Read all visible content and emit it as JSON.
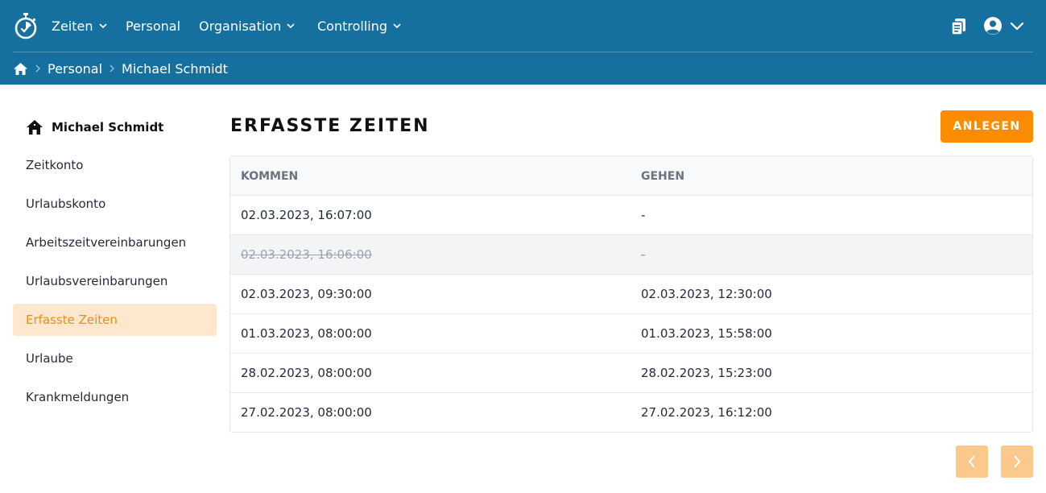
{
  "app": {
    "nav": [
      {
        "label": "Zeiten",
        "has_dropdown": true
      },
      {
        "label": "Personal",
        "has_dropdown": false
      },
      {
        "label": "Organisation",
        "has_dropdown": true
      },
      {
        "label": "Controlling",
        "has_dropdown": true
      }
    ],
    "icons": {
      "logo": "stopwatch-logo-icon",
      "documents": "clipboard-documents-icon",
      "user": "user-circle-icon",
      "user_menu": "chevron-down-icon"
    }
  },
  "breadcrumb": {
    "home_icon": "home-icon",
    "items": [
      "Personal",
      "Michael Schmidt"
    ]
  },
  "sidebar": {
    "title": "Michael Schmidt",
    "title_icon": "home-icon",
    "items": [
      {
        "label": "Zeitkonto",
        "active": false
      },
      {
        "label": "Urlaubskonto",
        "active": false
      },
      {
        "label": "Arbeitszeitvereinbarungen",
        "active": false
      },
      {
        "label": "Urlaubsvereinbarungen",
        "active": false
      },
      {
        "label": "Erfasste Zeiten",
        "active": true
      },
      {
        "label": "Urlaube",
        "active": false
      },
      {
        "label": "Krankmeldungen",
        "active": false
      }
    ]
  },
  "main": {
    "title": "ERFASSTE ZEITEN",
    "create_label": "ANLEGEN",
    "table": {
      "columns": [
        "KOMMEN",
        "GEHEN"
      ],
      "rows": [
        {
          "kommen": "02.03.2023, 16:07:00",
          "gehen": "-",
          "deleted": false
        },
        {
          "kommen": "02.03.2023, 16:06:00",
          "gehen": "-",
          "deleted": true
        },
        {
          "kommen": "02.03.2023, 09:30:00",
          "gehen": "02.03.2023, 12:30:00",
          "deleted": false
        },
        {
          "kommen": "01.03.2023, 08:00:00",
          "gehen": "01.03.2023, 15:58:00",
          "deleted": false
        },
        {
          "kommen": "28.02.2023, 08:00:00",
          "gehen": "28.02.2023, 15:23:00",
          "deleted": false
        },
        {
          "kommen": "27.02.2023, 08:00:00",
          "gehen": "27.02.2023, 16:12:00",
          "deleted": false
        }
      ]
    },
    "pagination": {
      "prev_icon": "chevron-left-icon",
      "next_icon": "chevron-right-icon"
    }
  },
  "colors": {
    "header_bg": "#16709f",
    "accent": "#fb8c00",
    "active_bg": "#fde8cf",
    "active_text": "#f28c0f",
    "pager_disabled": "#fcc98c"
  }
}
